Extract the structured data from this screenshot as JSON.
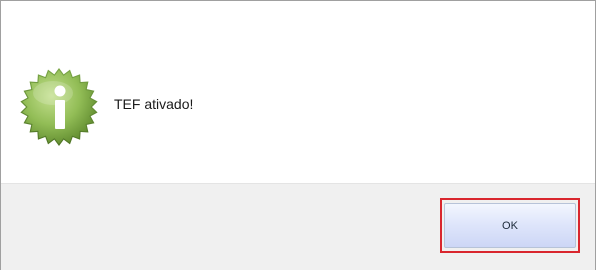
{
  "dialog": {
    "icon": "info-badge-icon",
    "message": "TEF ativado!",
    "ok_label": "OK"
  },
  "colors": {
    "icon_green_light": "#a8cf70",
    "icon_green_dark": "#6f9c39",
    "highlight_red": "#d9262e",
    "footer_bg": "#f0f0f0",
    "button_gradient_top": "#f3f6fe",
    "button_gradient_bottom": "#cdd6f6"
  }
}
